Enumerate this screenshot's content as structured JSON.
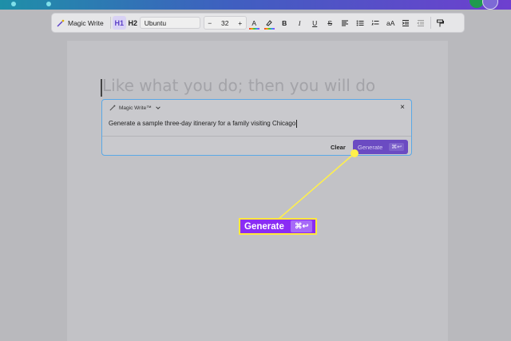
{
  "toolbar": {
    "magic_write_label": "Magic Write",
    "h1_label": "H1",
    "h2_label": "H2",
    "font_name": "Ubuntu",
    "font_size_minus": "−",
    "font_size": "32",
    "font_size_plus": "+",
    "text_color_glyph": "A",
    "bold_glyph": "B",
    "italic_glyph": "I",
    "underline_glyph": "U",
    "strike_glyph": "S",
    "align_icon": "align-left-icon",
    "list_icon": "bullet-list-icon",
    "numbered_list_icon": "numbered-list-icon",
    "text_case_glyph": "aA",
    "indent_icon": "indent-icon",
    "outdent_icon": "outdent-icon",
    "format_painter_icon": "paint-roller-icon"
  },
  "document": {
    "ghost_text": "Like what you do; then you will do"
  },
  "magic_write_panel": {
    "title": "Magic Write™",
    "close_glyph": "×",
    "prompt": "Generate a sample three-day itinerary for a family visiting Chicago",
    "clear_label": "Clear",
    "generate_label": "Generate",
    "generate_shortcut": "⌘↩"
  },
  "callout": {
    "label": "Generate",
    "shortcut": "⌘↩"
  },
  "colors": {
    "accent": "#6b4bc2",
    "callout_bg": "#8a2cf4",
    "callout_border": "#ffe93c",
    "pointer": "#fff04a"
  }
}
